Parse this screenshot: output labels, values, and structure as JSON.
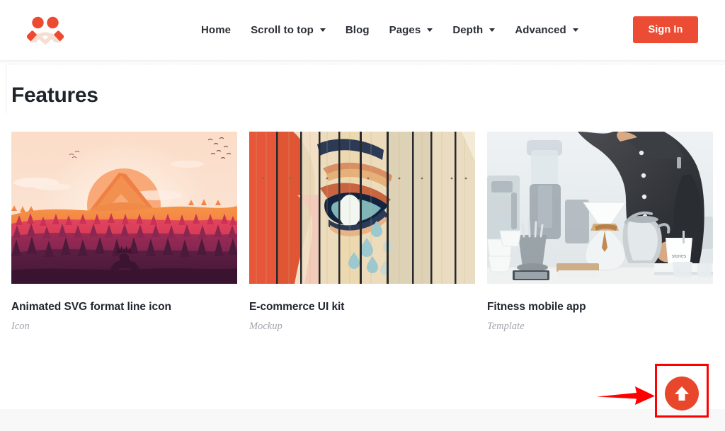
{
  "header": {
    "logo_name": "site-logo",
    "nav_items": [
      {
        "label": "Home",
        "has_dropdown": false
      },
      {
        "label": "Scroll to top",
        "has_dropdown": true
      },
      {
        "label": "Blog",
        "has_dropdown": false
      },
      {
        "label": "Pages",
        "has_dropdown": true
      },
      {
        "label": "Depth",
        "has_dropdown": true
      },
      {
        "label": "Advanced",
        "has_dropdown": true
      }
    ],
    "signin_label": "Sign In"
  },
  "main": {
    "page_title": "Features",
    "cards": [
      {
        "title": "Animated SVG format line icon",
        "category": "Icon",
        "image_alt": "sunset-mountain-forest-illustration"
      },
      {
        "title": "E-commerce UI kit",
        "category": "Mockup",
        "image_alt": "street-art-eye-mural-on-wooden-fence"
      },
      {
        "title": "Fitness mobile app",
        "category": "Template",
        "image_alt": "barista-making-pour-over-coffee"
      }
    ]
  },
  "scroll_top": {
    "icon": "arrow-up-icon",
    "label": "Scroll to top"
  },
  "annotation": {
    "arrow": "red-pointer-arrow",
    "highlight": "red-highlight-box"
  },
  "colors": {
    "accent": "#ec4c33",
    "scroll_button": "#e8472b",
    "annotation_red": "#ff0000",
    "text_dark": "#22262e",
    "text_muted": "#a3a6ad",
    "footer_band": "#f8f8f9"
  }
}
